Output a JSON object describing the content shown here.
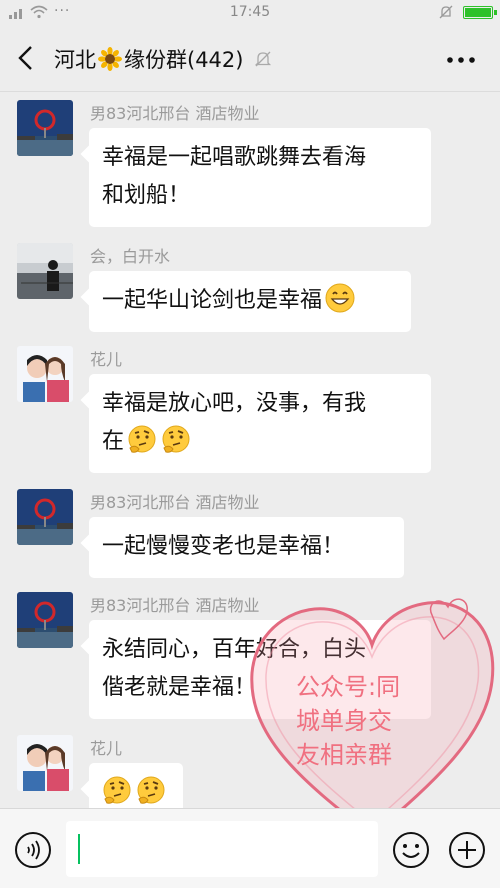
{
  "status_bar": {
    "time": "17:45",
    "dots": "···"
  },
  "nav": {
    "title_prefix": "河北",
    "title_suffix": "缘份群(442)"
  },
  "messages": [
    {
      "sender": "男83河北邢台 酒店物业",
      "lines": [
        "幸福是一起唱歌跳舞去看海",
        "和划船！"
      ],
      "avatar": "landscape-avatar"
    },
    {
      "sender": "会，白开水",
      "lines": [
        "一起华山论剑也是幸福"
      ],
      "emoji": "grinning-emoji",
      "avatar": "silhouette-avatar"
    },
    {
      "sender": "花儿",
      "lines": [
        "幸福是放心吧，没事，有我",
        "在"
      ],
      "emoji": "thinking-emoji",
      "avatar": "couple-avatar"
    },
    {
      "sender": "男83河北邢台 酒店物业",
      "lines": [
        "一起慢慢变老也是幸福！"
      ],
      "avatar": "landscape-avatar"
    },
    {
      "sender": "男83河北邢台 酒店物业",
      "lines": [
        "永结同心，百年好合，白头",
        "偕老就是幸福！"
      ],
      "avatar": "landscape-avatar"
    },
    {
      "sender": "花儿",
      "lines": [],
      "emoji": "thinking-emoji",
      "avatar": "couple-avatar"
    }
  ],
  "watermark": {
    "lines": [
      "公众号:同",
      "城单身交",
      "友相亲群"
    ]
  },
  "colors": {
    "accent": "#07c160",
    "battery": "#2ec12a",
    "watermark": "#f07080",
    "background": "#ededed"
  }
}
